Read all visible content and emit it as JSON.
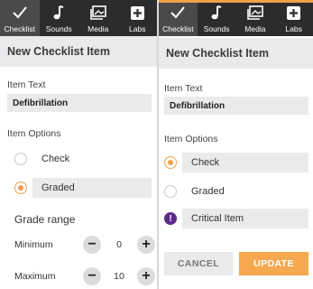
{
  "tabs": [
    {
      "label": "Checklist",
      "icon": "checkmark-icon"
    },
    {
      "label": "Sounds",
      "icon": "music-note-icon"
    },
    {
      "label": "Media",
      "icon": "image-icon"
    },
    {
      "label": "Labs",
      "icon": "plus-box-icon"
    }
  ],
  "left": {
    "title": "New Checklist Item",
    "item_text_label": "Item Text",
    "item_text_value": "Defibrillation",
    "item_options_label": "Item Options",
    "options": [
      {
        "label": "Check",
        "selected": false
      },
      {
        "label": "Graded",
        "selected": true
      }
    ],
    "grade_range_label": "Grade range",
    "minimum": {
      "label": "Minimum",
      "minus": "−",
      "value": "0",
      "plus": "+"
    },
    "maximum": {
      "label": "Maximum",
      "minus": "−",
      "value": "10",
      "plus": "+"
    }
  },
  "right": {
    "title": "New Checklist Item",
    "item_text_label": "Item Text",
    "item_text_value": "Defibrillation",
    "item_options_label": "Item Options",
    "options": [
      {
        "label": "Check",
        "selected": true
      },
      {
        "label": "Graded",
        "selected": false
      }
    ],
    "critical_icon": "!",
    "critical_label": "Critical Item",
    "cancel_label": "CANCEL",
    "update_label": "UPDATE"
  },
  "colors": {
    "accent": "#f0a04b",
    "tab_bar": "#2c2c2c",
    "field_bg": "#e9eaec",
    "critical": "#5b2a86"
  }
}
